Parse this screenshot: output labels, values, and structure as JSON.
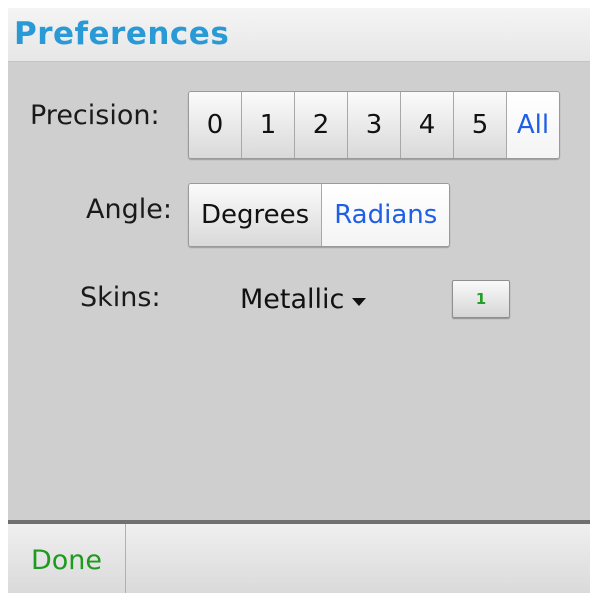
{
  "window": {
    "title": "Preferences"
  },
  "precision": {
    "label": "Precision:",
    "options": [
      "0",
      "1",
      "2",
      "3",
      "4",
      "5",
      "All"
    ],
    "selected": "All"
  },
  "angle": {
    "label": "Angle:",
    "options": [
      "Degrees",
      "Radians"
    ],
    "selected": "Radians"
  },
  "skins": {
    "label": "Skins:",
    "selected_value": "Metallic",
    "preview_button_label": "1"
  },
  "toolbar": {
    "done_label": "Done"
  },
  "colors": {
    "title": "#2a9ad6",
    "selected_option": "#1f5fe6",
    "done": "#1e9a1e"
  }
}
